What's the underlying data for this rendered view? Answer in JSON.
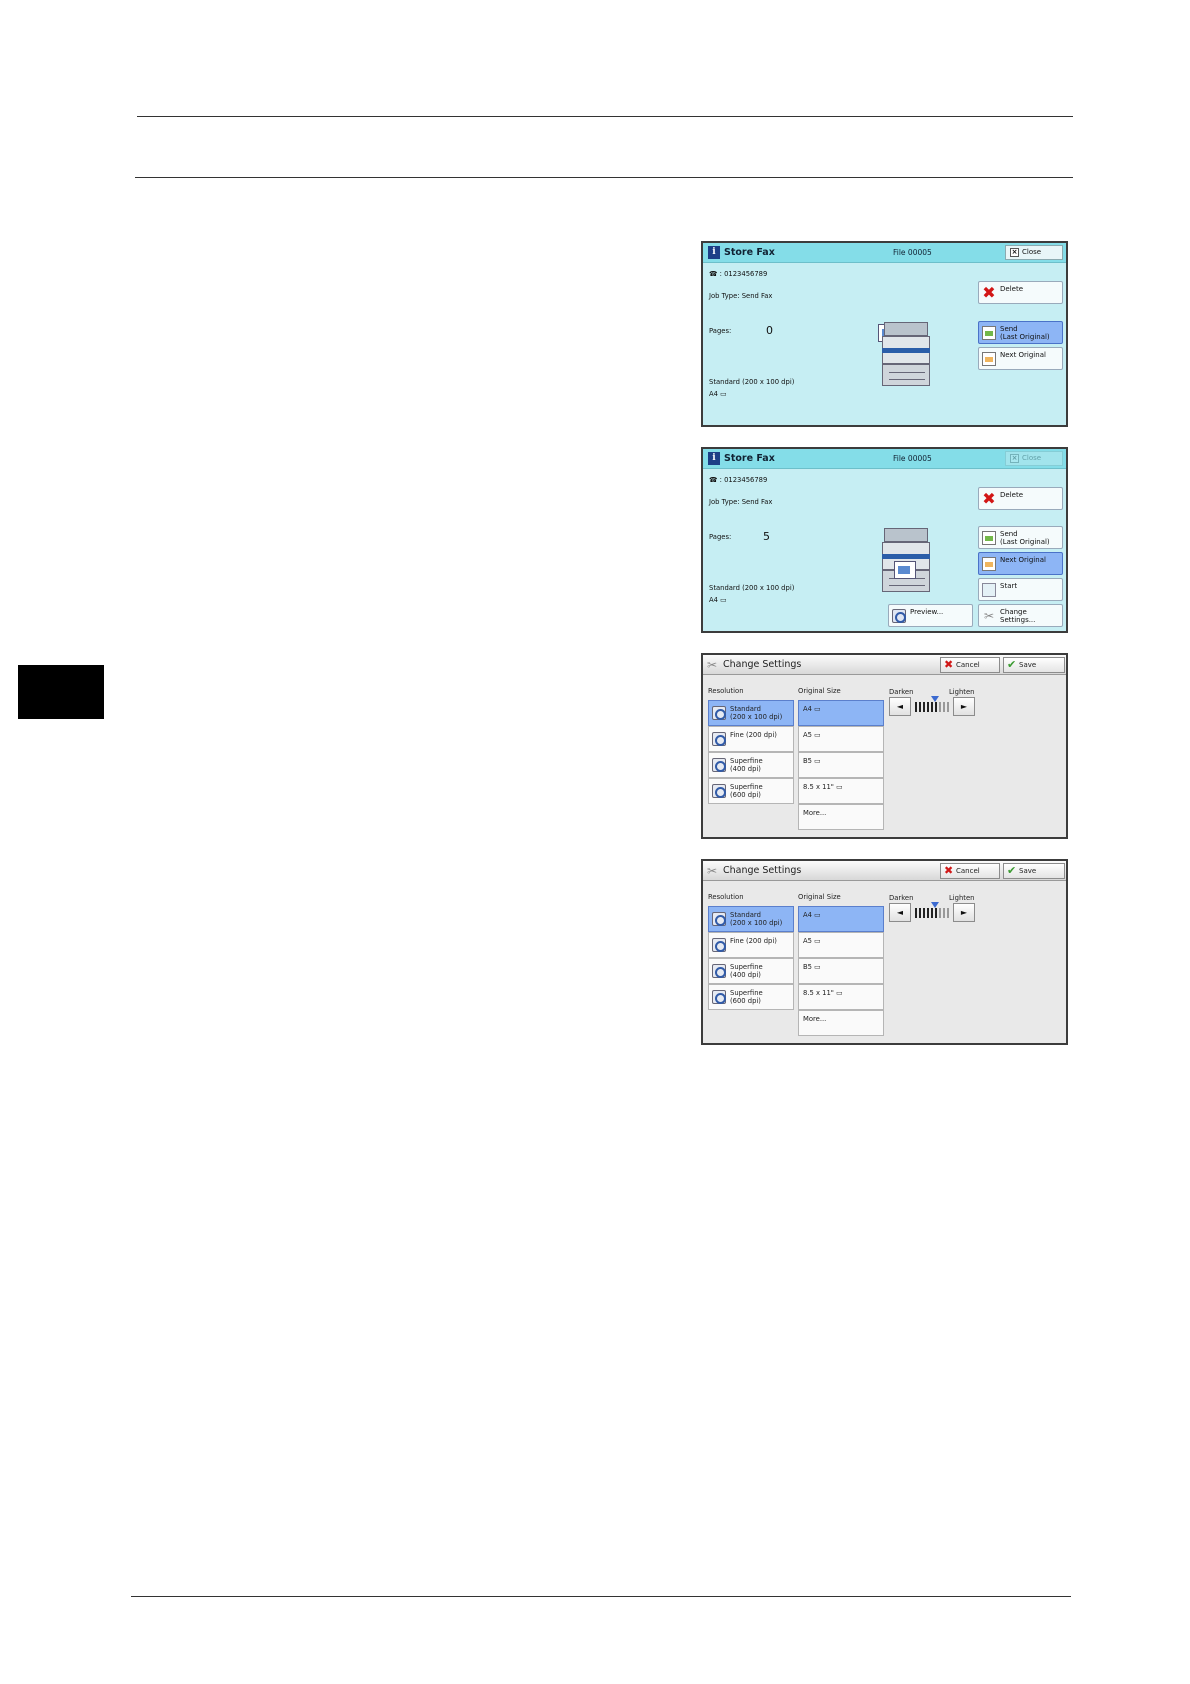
{
  "screens": {
    "store_fax_1": {
      "title": "Store Fax",
      "file": "File 00005",
      "close": "Close",
      "phone": "☎ : 0123456789",
      "job_type": "Job Type: Send Fax",
      "pages_label": "Pages:",
      "pages_value": "0",
      "resolution": "Standard (200 x 100 dpi)",
      "size": "A4 ▭",
      "buttons": {
        "delete": "Delete",
        "send_line1": "Send",
        "send_line2": "(Last Original)",
        "next": "Next Original"
      }
    },
    "store_fax_2": {
      "title": "Store Fax",
      "file": "File 00005",
      "close": "Close",
      "phone": "☎ : 0123456789",
      "job_type": "Job Type: Send Fax",
      "pages_label": "Pages:",
      "pages_value": "5",
      "resolution": "Standard (200 x 100 dpi)",
      "size": "A4 ▭",
      "buttons": {
        "delete": "Delete",
        "send_line1": "Send",
        "send_line2": "(Last Original)",
        "next": "Next Original",
        "start": "Start",
        "preview": "Preview...",
        "change_line1": "Change",
        "change_line2": "Settings..."
      }
    },
    "change_settings": {
      "title": "Change Settings",
      "cancel": "Cancel",
      "save": "Save",
      "resolution_header": "Resolution",
      "size_header": "Original Size",
      "darken": "Darken",
      "lighten": "Lighten",
      "left_arrow": "◄",
      "right_arrow": "►",
      "resolutions": [
        {
          "line1": "Standard",
          "line2": "(200 x 100 dpi)"
        },
        {
          "line1": "Fine (200 dpi)",
          "line2": ""
        },
        {
          "line1": "Superfine",
          "line2": "(400 dpi)"
        },
        {
          "line1": "Superfine",
          "line2": "(600 dpi)"
        }
      ],
      "sizes": [
        "A4 ▭",
        "A5 ▭",
        "B5 ▭",
        "8.5 x 11\" ▭",
        "More..."
      ]
    }
  },
  "icons": {
    "delete": "red-x",
    "send": "document-arrow",
    "next": "document-arrow",
    "start": "start-icon",
    "preview": "magnifier",
    "change": "tools",
    "cancel": "red-x",
    "save": "green-check"
  },
  "colors": {
    "fax_background": "#c6eef3",
    "title_bar": "#84dde8",
    "selected": "#8db5f5",
    "settings_background": "#e9e9e9"
  }
}
